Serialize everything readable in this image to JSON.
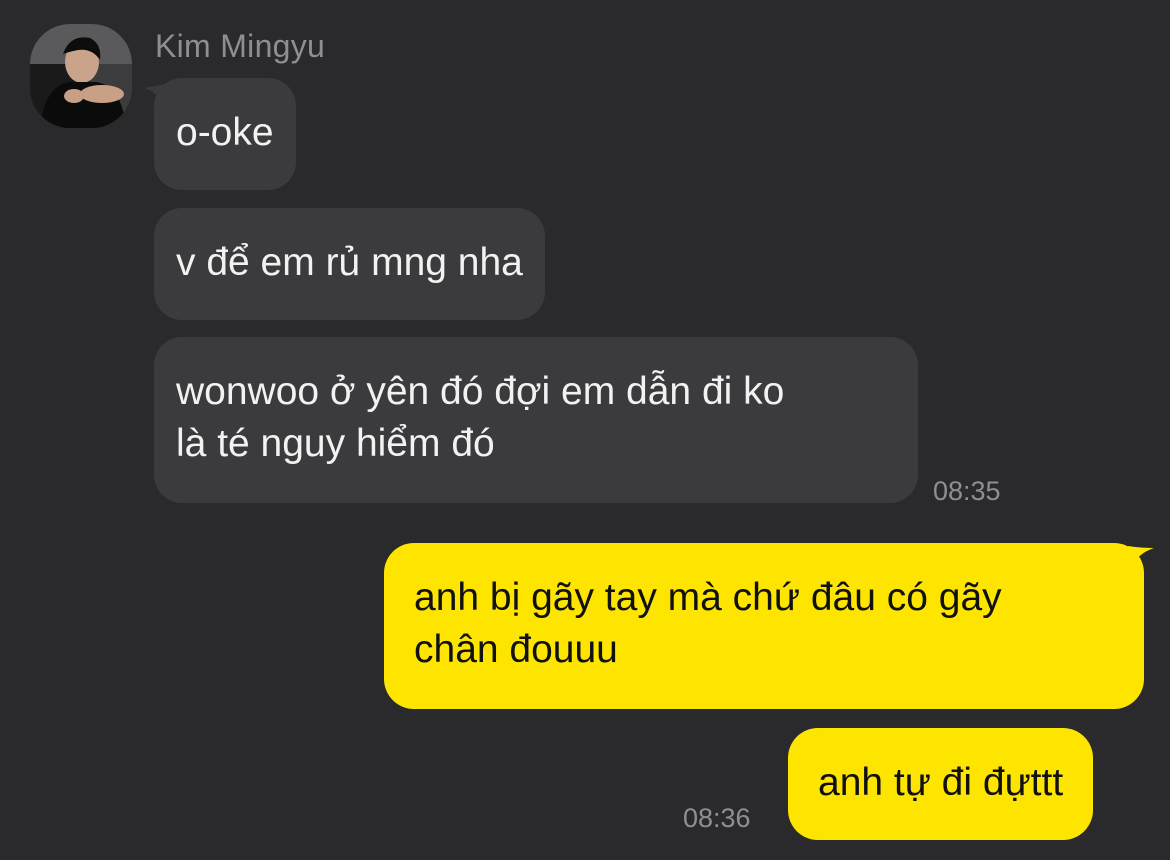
{
  "contact": {
    "name": "Kim Mingyu"
  },
  "messages": [
    {
      "direction": "incoming",
      "text": "o-oke"
    },
    {
      "direction": "incoming",
      "text": "v để em rủ mng nha"
    },
    {
      "direction": "incoming",
      "lines": [
        "wonwoo ở yên đó đợi em dẫn đi ko",
        "là té nguy hiểm đó"
      ],
      "time": "08:35"
    },
    {
      "direction": "outgoing",
      "lines": [
        "anh bị gãy tay mà chứ đâu có gãy",
        "chân đouuu"
      ]
    },
    {
      "direction": "outgoing",
      "text": "anh tự đi đựttt",
      "time": "08:36"
    }
  ],
  "colors": {
    "background": "#2a2a2c",
    "incoming_bubble": "#3b3b3e",
    "outgoing_bubble": "#fee500",
    "timestamp": "#8f8f93"
  },
  "icons": {
    "avatar": "profile-photo"
  }
}
